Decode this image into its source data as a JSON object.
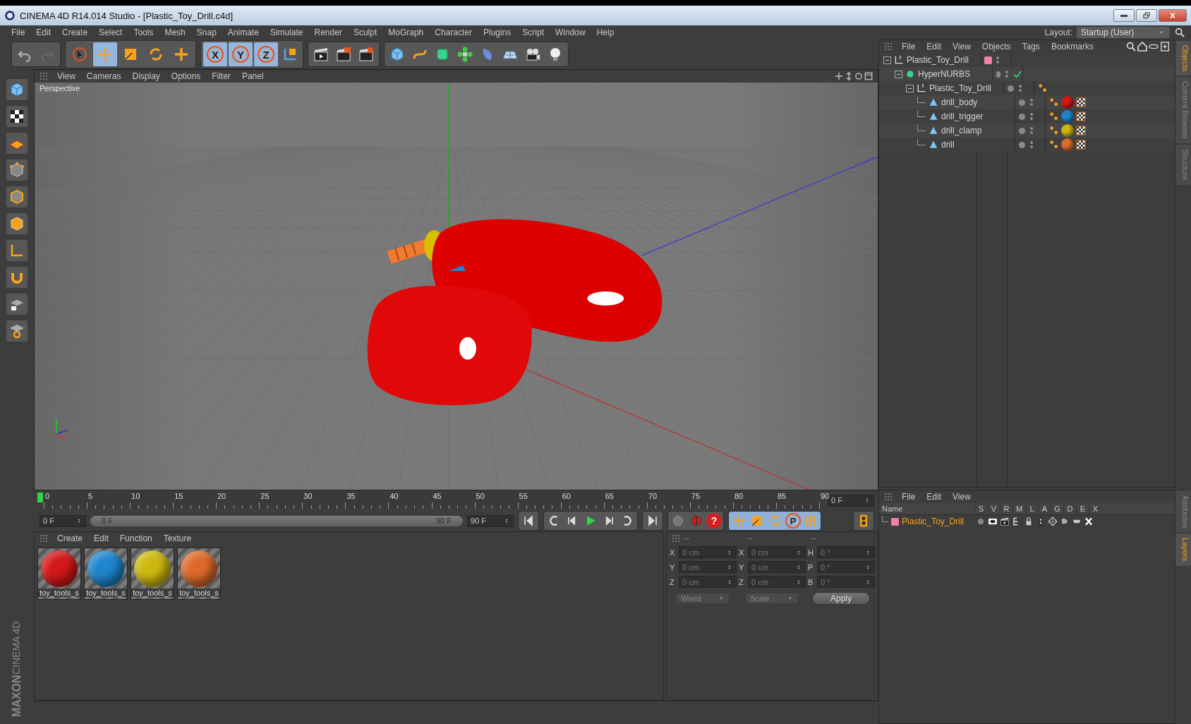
{
  "window": {
    "title": "CINEMA 4D R14.014 Studio - [Plastic_Toy_Drill.c4d]"
  },
  "menu": [
    "File",
    "Edit",
    "Create",
    "Select",
    "Tools",
    "Mesh",
    "Snap",
    "Animate",
    "Simulate",
    "Render",
    "Sculpt",
    "MoGraph",
    "Character",
    "Plugins",
    "Script",
    "Window",
    "Help"
  ],
  "layout": {
    "label": "Layout:",
    "value": "Startup (User)"
  },
  "toolbar": {
    "tools": [
      {
        "kind": "select",
        "selected": false
      },
      {
        "kind": "move",
        "selected": true
      },
      {
        "kind": "scale",
        "selected": false
      },
      {
        "kind": "rotate",
        "selected": false
      },
      {
        "kind": "create",
        "selected": false
      }
    ],
    "axes": [
      {
        "label": "X",
        "on": true
      },
      {
        "label": "Y",
        "on": true
      },
      {
        "label": "Z",
        "on": true
      }
    ]
  },
  "viewport": {
    "menu": [
      "View",
      "Cameras",
      "Display",
      "Options",
      "Filter",
      "Panel"
    ],
    "camera": "Perspective"
  },
  "timeline": {
    "ticks": [
      "0",
      "5",
      "10",
      "15",
      "20",
      "25",
      "30",
      "35",
      "40",
      "45",
      "50",
      "55",
      "60",
      "65",
      "70",
      "75",
      "80",
      "85",
      "90"
    ],
    "level": 0,
    "frame": "0 F"
  },
  "transport": {
    "start": "0 F",
    "level": 1,
    "range_start": "0 F",
    "range_end": "90 F",
    "end": "90 F",
    "help": "?",
    "param": "P"
  },
  "materials": {
    "menu": [
      "Create",
      "Edit",
      "Function",
      "Texture"
    ],
    "items": [
      {
        "name": "toy_tools_s",
        "color": "#d41818"
      },
      {
        "name": "toy_tools_s",
        "color": "#1e86cc"
      },
      {
        "name": "toy_tools_s",
        "color": "#cdb810"
      },
      {
        "name": "toy_tools_s",
        "color": "#dc6a2a"
      }
    ]
  },
  "coordinates": {
    "headers": [
      "--",
      "--",
      "--"
    ],
    "rows": [
      {
        "axis": "X",
        "position": "0 cm",
        "size_axis": "X",
        "size": "0 cm",
        "rot_axis": "H",
        "rotation": "0 °"
      },
      {
        "axis": "Y",
        "position": "0 cm",
        "size_axis": "Y",
        "size": "0 cm",
        "rot_axis": "P",
        "rotation": "0 °"
      },
      {
        "axis": "Z",
        "position": "0 cm",
        "size_axis": "Z",
        "size": "0 cm",
        "rot_axis": "B",
        "rotation": "0 °"
      }
    ],
    "space": "World",
    "mode": "Scale",
    "apply": "Apply"
  },
  "object_manager": {
    "menu": [
      "File",
      "Edit",
      "View",
      "Objects",
      "Tags",
      "Bookmarks"
    ],
    "tree": [
      {
        "name": "Plastic_Toy_Drill",
        "kind": "null",
        "color": "#f080a8",
        "expanded": true,
        "enabled": false,
        "children": [
          {
            "name": "HyperNURBS",
            "kind": "generator",
            "expanded": true,
            "enabled": true,
            "children": [
              {
                "name": "Plastic_Toy_Drill",
                "kind": "null",
                "expanded": true,
                "enabled": false,
                "tags": [
                  {
                    "kind": "phong"
                  }
                ],
                "children": [
                  {
                    "name": "drill_body",
                    "kind": "polygon",
                    "enabled": false,
                    "tags": [
                      {
                        "kind": "phong"
                      },
                      {
                        "kind": "material",
                        "color": "#d41818"
                      },
                      {
                        "kind": "uvw"
                      }
                    ]
                  },
                  {
                    "name": "drill_trigger",
                    "kind": "polygon",
                    "enabled": false,
                    "tags": [
                      {
                        "kind": "phong"
                      },
                      {
                        "kind": "material",
                        "color": "#1e86cc"
                      },
                      {
                        "kind": "uvw"
                      }
                    ]
                  },
                  {
                    "name": "drill_clamp",
                    "kind": "polygon",
                    "enabled": false,
                    "tags": [
                      {
                        "kind": "phong"
                      },
                      {
                        "kind": "material",
                        "color": "#cdb810"
                      },
                      {
                        "kind": "uvw"
                      }
                    ]
                  },
                  {
                    "name": "drill",
                    "kind": "polygon",
                    "enabled": false,
                    "tags": [
                      {
                        "kind": "phong"
                      },
                      {
                        "kind": "material",
                        "color": "#dc6a2a"
                      },
                      {
                        "kind": "uvw"
                      }
                    ]
                  }
                ]
              }
            ]
          }
        ]
      }
    ]
  },
  "side_tabs_top": [
    {
      "label": "Objects",
      "selected": true
    },
    {
      "label": "Content Browser",
      "selected": false
    },
    {
      "label": "Structure",
      "selected": false
    }
  ],
  "layer_manager": {
    "menu": [
      "File",
      "Edit",
      "View"
    ],
    "columns": [
      "Name",
      "S",
      "V",
      "R",
      "M",
      "L",
      "A",
      "G",
      "D",
      "E",
      "X"
    ],
    "layers": [
      {
        "name": "Plastic_Toy_Drill",
        "color": "#f080a8",
        "selected": true
      }
    ]
  },
  "side_tabs_bottom": [
    {
      "label": "Attributes",
      "selected": false
    },
    {
      "label": "Layers",
      "selected": true
    }
  ],
  "logo": [
    "MAXON",
    "CINEMA 4D"
  ]
}
